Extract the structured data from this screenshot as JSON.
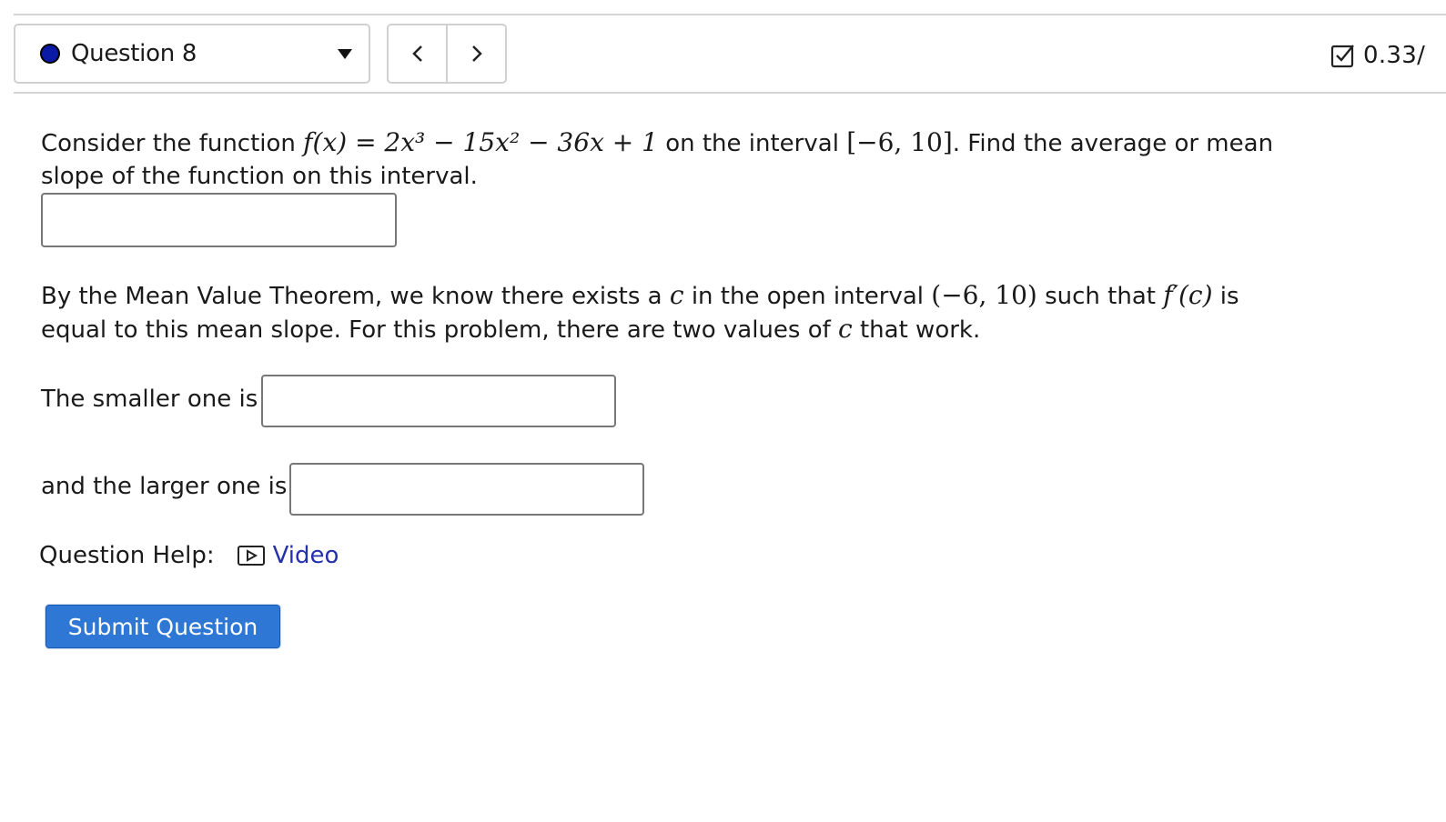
{
  "header": {
    "question_label": "Question 8",
    "prev_label": "<",
    "next_label": ">",
    "score": "0.33/"
  },
  "question": {
    "p1_before": "Consider the function ",
    "function_expr": "f(x) = 2x³ − 15x² − 36x + 1",
    "p1_mid": " on the interval ",
    "interval_closed": "[−6, 10]",
    "p1_after": ". Find the average or mean",
    "p1_line2": "slope of the function on this interval.",
    "p2_before": "By the Mean Value Theorem, we know there exists a ",
    "c_symbol": "c",
    "p2_mid": " in the open interval ",
    "interval_open": "(−6, 10)",
    "p2_mid2": " such that ",
    "derivative_expr": "f′(c)",
    "p2_after": " is",
    "p2_line2_before": "equal to this mean slope. For this problem, there are two values of ",
    "p2_line2_after": " that work.",
    "smaller_label": "The smaller one is",
    "larger_label": "and the larger one is"
  },
  "inputs": {
    "mean_slope_value": "",
    "smaller_value": "",
    "larger_value": ""
  },
  "help": {
    "label": "Question Help:",
    "video_label": "Video"
  },
  "submit_label": "Submit Question",
  "colors": {
    "dot": "#0a1aa6",
    "link": "#2531a8",
    "submit_bg": "#2f77d4"
  }
}
